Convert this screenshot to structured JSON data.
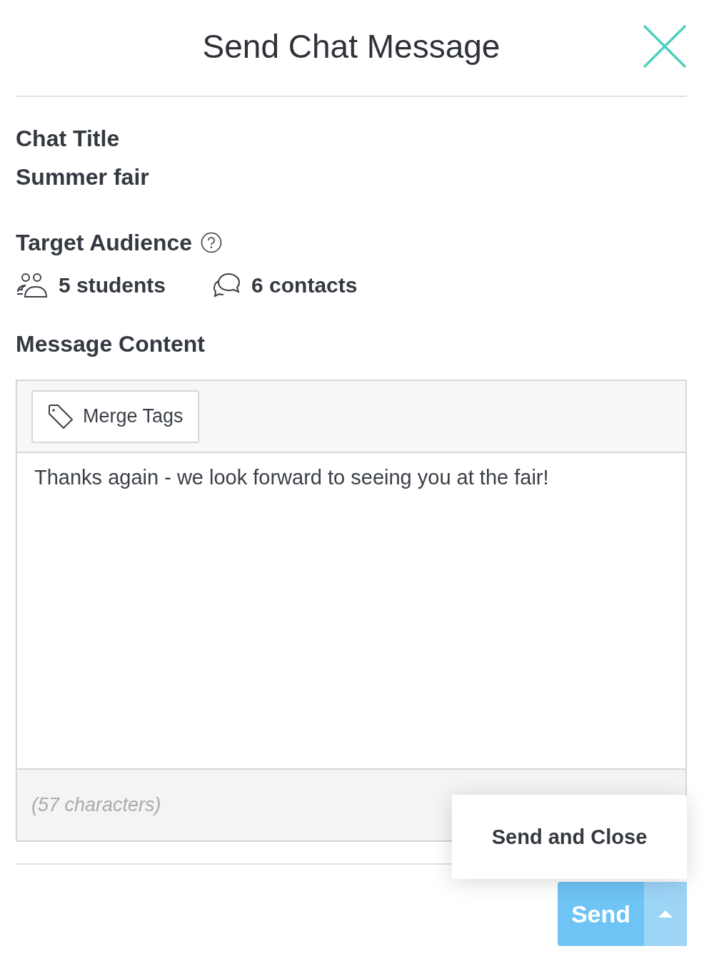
{
  "dialog": {
    "title": "Send Chat Message"
  },
  "chat_title": {
    "label": "Chat Title",
    "value": "Summer fair"
  },
  "audience": {
    "label": "Target Audience",
    "help": true,
    "recipients": [
      {
        "kind": "students",
        "text": "5 students"
      },
      {
        "kind": "contacts",
        "text": "6 contacts"
      }
    ]
  },
  "message": {
    "label": "Message Content",
    "merge_tags_button": "Merge Tags",
    "value": "Thanks again - we look forward to seeing you at the fair!",
    "char_count": "(57 characters)"
  },
  "send_menu": {
    "open": true,
    "items": [
      "Send and Close"
    ]
  },
  "send_button": {
    "label": "Send"
  }
}
